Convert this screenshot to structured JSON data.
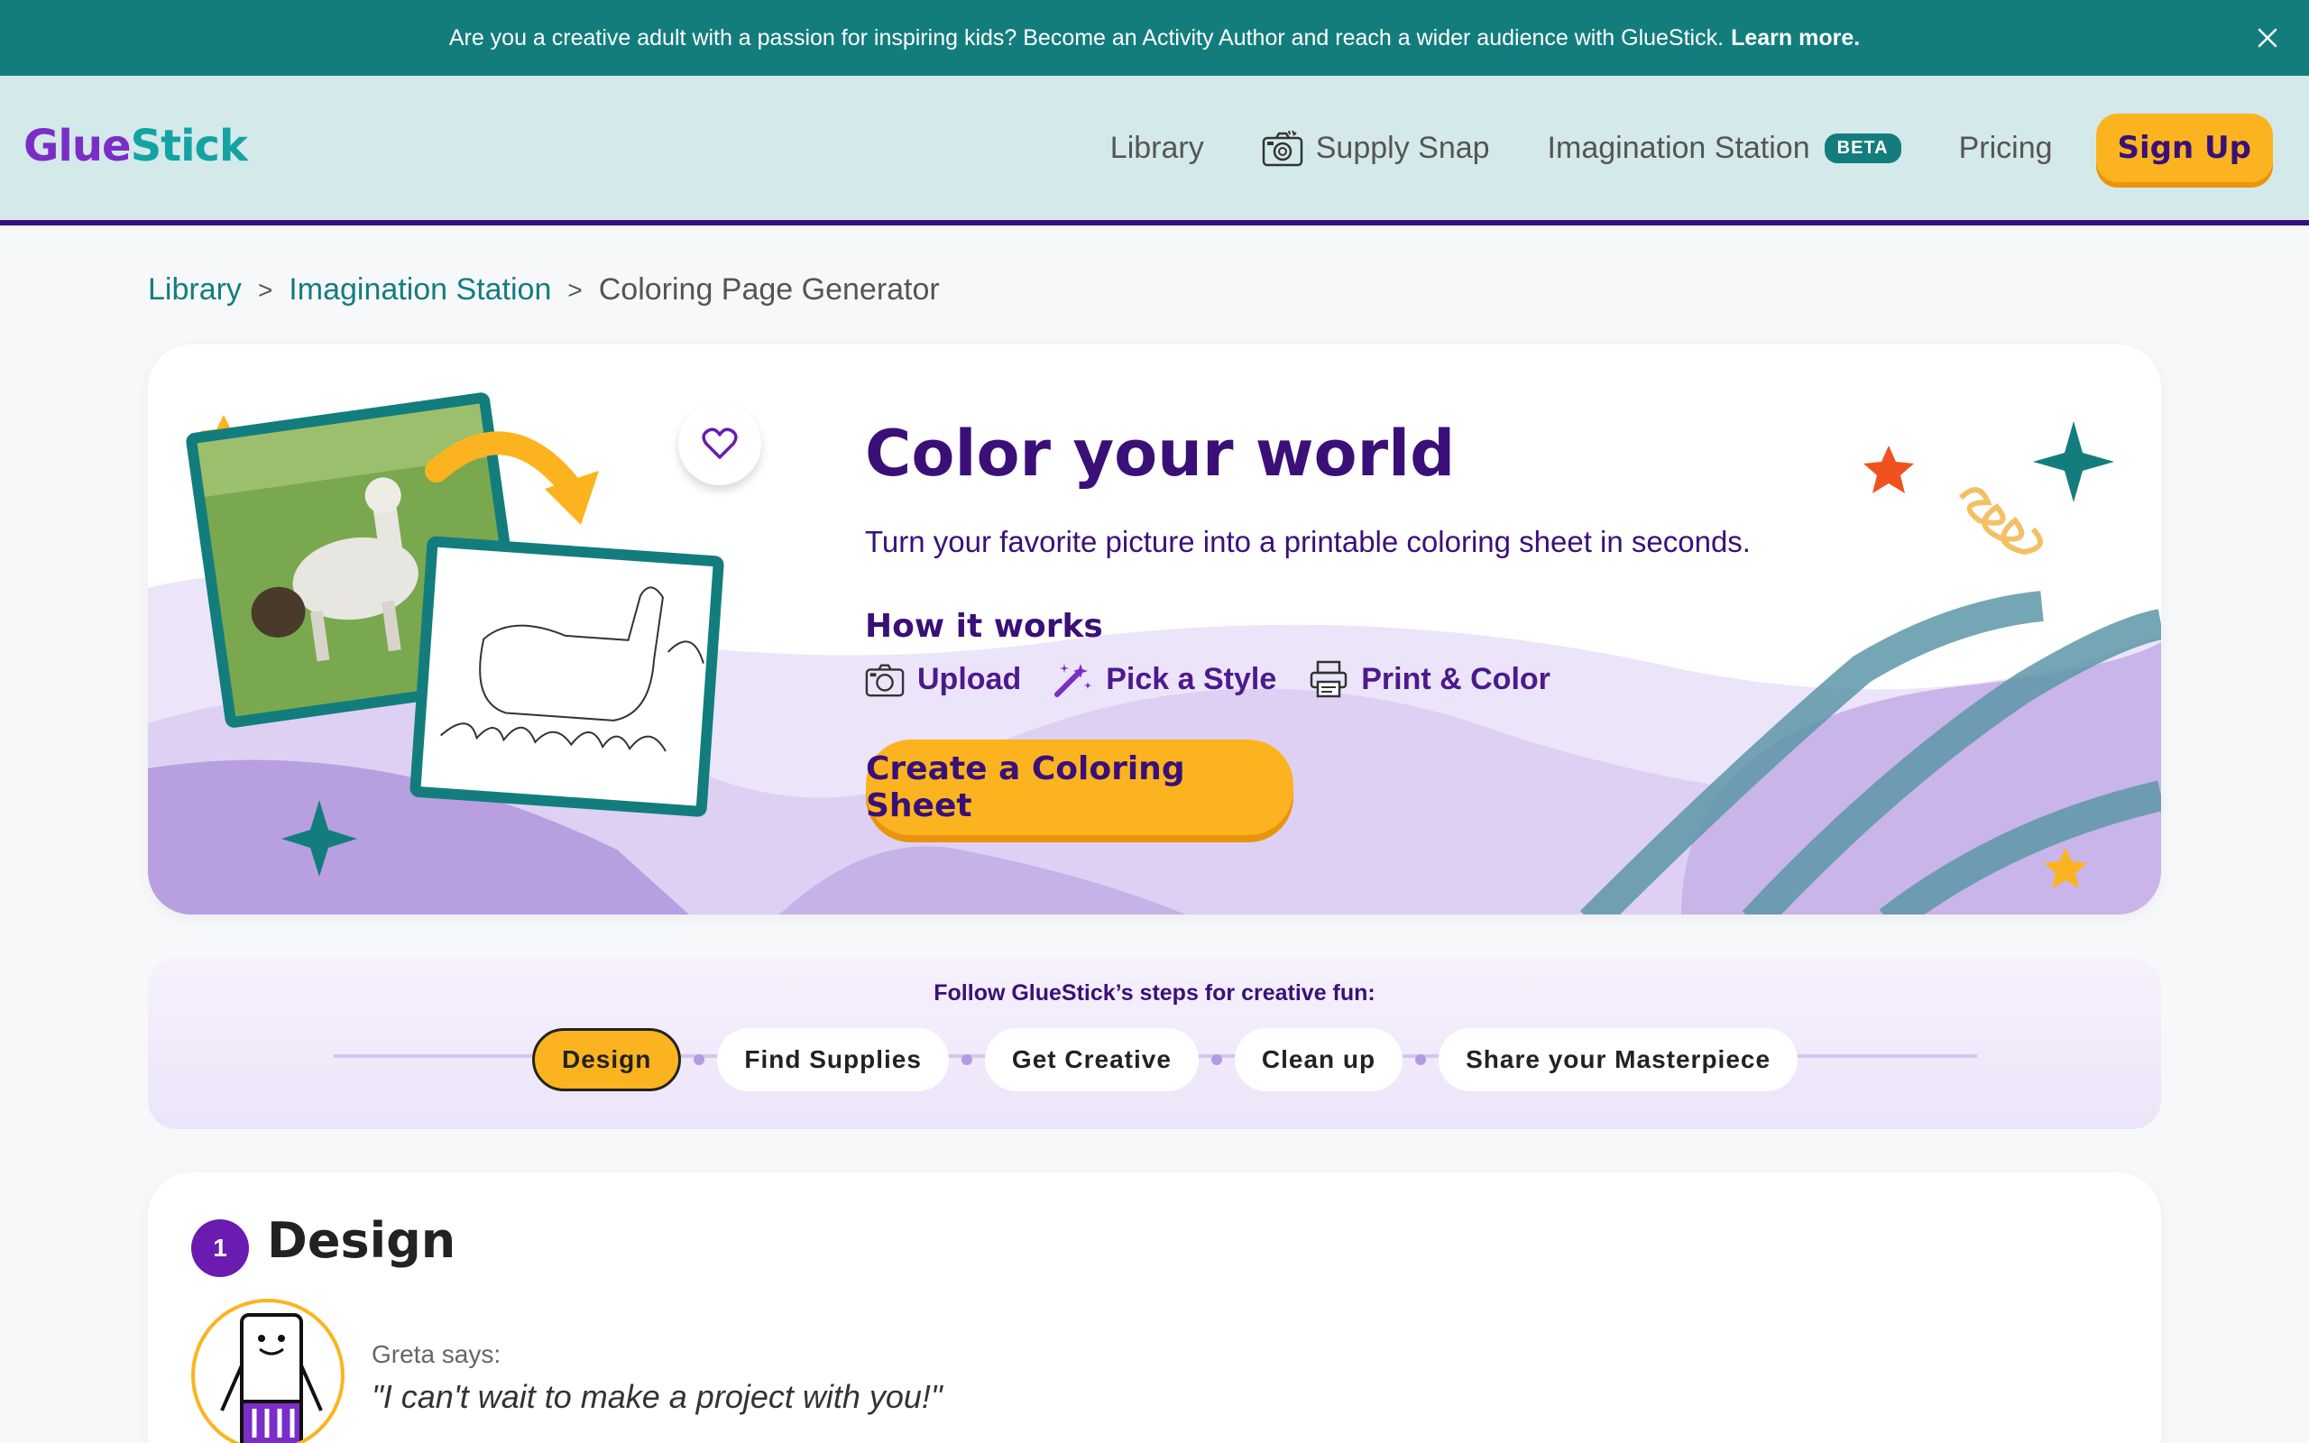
{
  "banner": {
    "text": "Are you a creative adult with a passion for inspiring kids? Become an Activity Author and reach a wider audience with GlueStick.",
    "link": "Learn more.",
    "close_icon": "close-icon"
  },
  "header": {
    "logo_part1": "Glue",
    "logo_part2": "Stick",
    "nav": {
      "library": "Library",
      "supply_snap": "Supply Snap",
      "imagination_station": "Imagination Station",
      "beta": "BETA",
      "pricing": "Pricing",
      "signup": "Sign Up"
    }
  },
  "breadcrumb": {
    "items": [
      "Library",
      "Imagination Station"
    ],
    "separator": ">",
    "current": "Coloring Page Generator"
  },
  "hero": {
    "title": "Color your world",
    "subtitle": "Turn your favorite picture into a printable coloring sheet in seconds.",
    "how_title": "How it works",
    "steps": [
      "Upload",
      "Pick a Style",
      "Print & Color"
    ],
    "cta": "Create a Coloring Sheet",
    "colors": {
      "primary": "#3a1078",
      "accent": "#fbb41f",
      "teal": "#137d7d"
    }
  },
  "steps_strip": {
    "label": "Follow GlueStick’s steps for creative fun:",
    "steps": [
      "Design",
      "Find Supplies",
      "Get Creative",
      "Clean up",
      "Share your Masterpiece"
    ],
    "active_index": 0
  },
  "design": {
    "number": "1",
    "title": "Design",
    "speaker": "Greta says:",
    "quote": "\"I can't wait to make a project with you!\""
  }
}
